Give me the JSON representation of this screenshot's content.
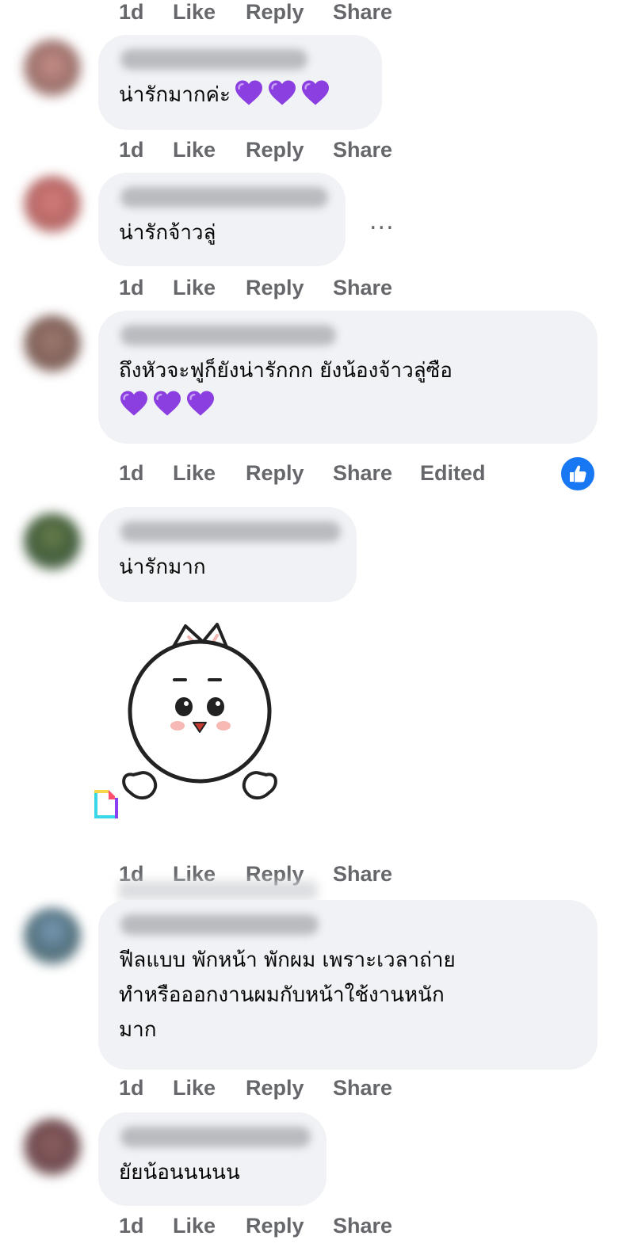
{
  "actions": {
    "time": "1d",
    "like": "Like",
    "reply": "Reply",
    "share": "Share",
    "edited": "Edited"
  },
  "comments": [
    {
      "text": "น่ารักมากค่ะ"
    },
    {
      "text": "น่ารักจ้าวลู่"
    },
    {
      "text_line1": "ถึงหัวจะฟูก็ยังน่ารักกก ยังน้องจ้าวลู่ซือ"
    },
    {
      "text": "น่ารักมาก"
    },
    {
      "line1": "ฟีลแบบ พักหน้า พักผม เพราะเวลาถ่าย",
      "line2": "ทำหรือออกงานผมกับหน้าใช้งานหนัก",
      "line3": "มาก"
    },
    {
      "text": "ยัยน้อนนนนน"
    }
  ],
  "more_label": "...",
  "colors": {
    "bubble": "#f0f2f5",
    "meta_text": "#65676b",
    "like_blue": "#1877f2",
    "heart": "#8b3fe0"
  },
  "icons": [
    "more-icon",
    "thumbs-up-icon",
    "purple-heart-icon",
    "sticker-image",
    "gif-icon"
  ]
}
